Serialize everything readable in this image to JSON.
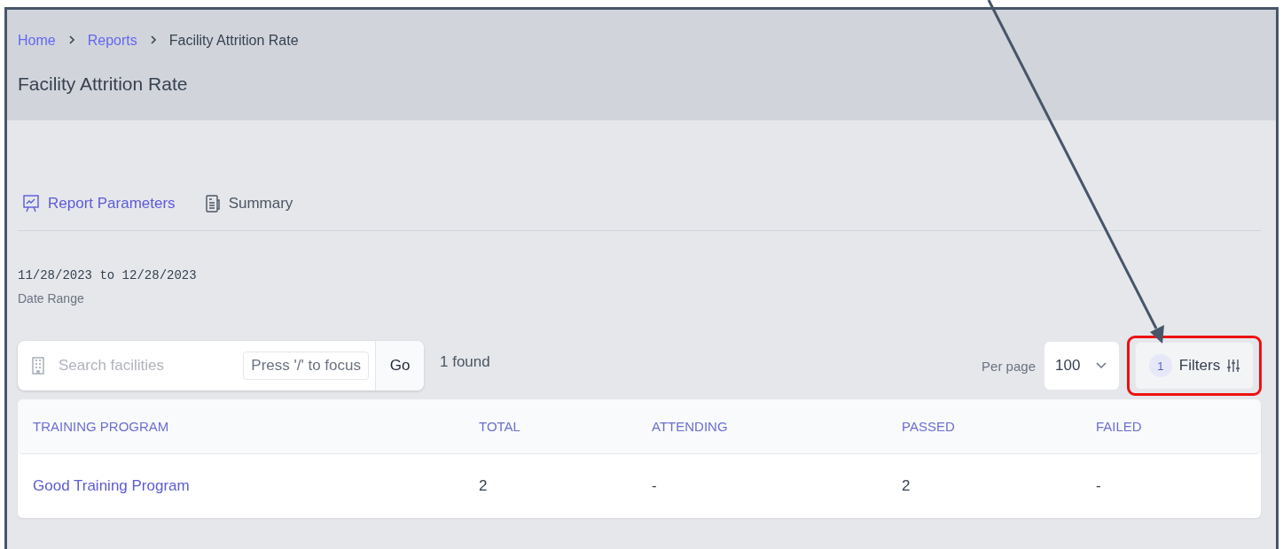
{
  "breadcrumbs": [
    {
      "label": "Home",
      "kind": "link"
    },
    {
      "label": "Reports",
      "kind": "link"
    },
    {
      "label": "Facility Attrition Rate",
      "kind": "current"
    }
  ],
  "title": "Facility Attrition Rate",
  "tabs": [
    {
      "label": "Report Parameters",
      "kind": "chart",
      "selected": true
    },
    {
      "label": "Summary",
      "kind": "document",
      "selected": false
    }
  ],
  "date_range": {
    "value": "11/28/2023 to 12/28/2023",
    "label": "Date Range"
  },
  "search": {
    "placeholder": "Search facilities",
    "shortcut_hint": "Press '/' to focus",
    "button": "Go"
  },
  "result_count": "1 found",
  "per_page": {
    "label": "Per page",
    "value": "100"
  },
  "filters": {
    "count": "1",
    "label": "Filters",
    "highlighted": true
  },
  "table": {
    "columns": [
      "TRAINING PROGRAM",
      "TOTAL",
      "ATTENDING",
      "PASSED",
      "FAILED"
    ],
    "rows": [
      [
        "Good Training Program",
        "2",
        "-",
        "2",
        "-"
      ]
    ]
  }
}
